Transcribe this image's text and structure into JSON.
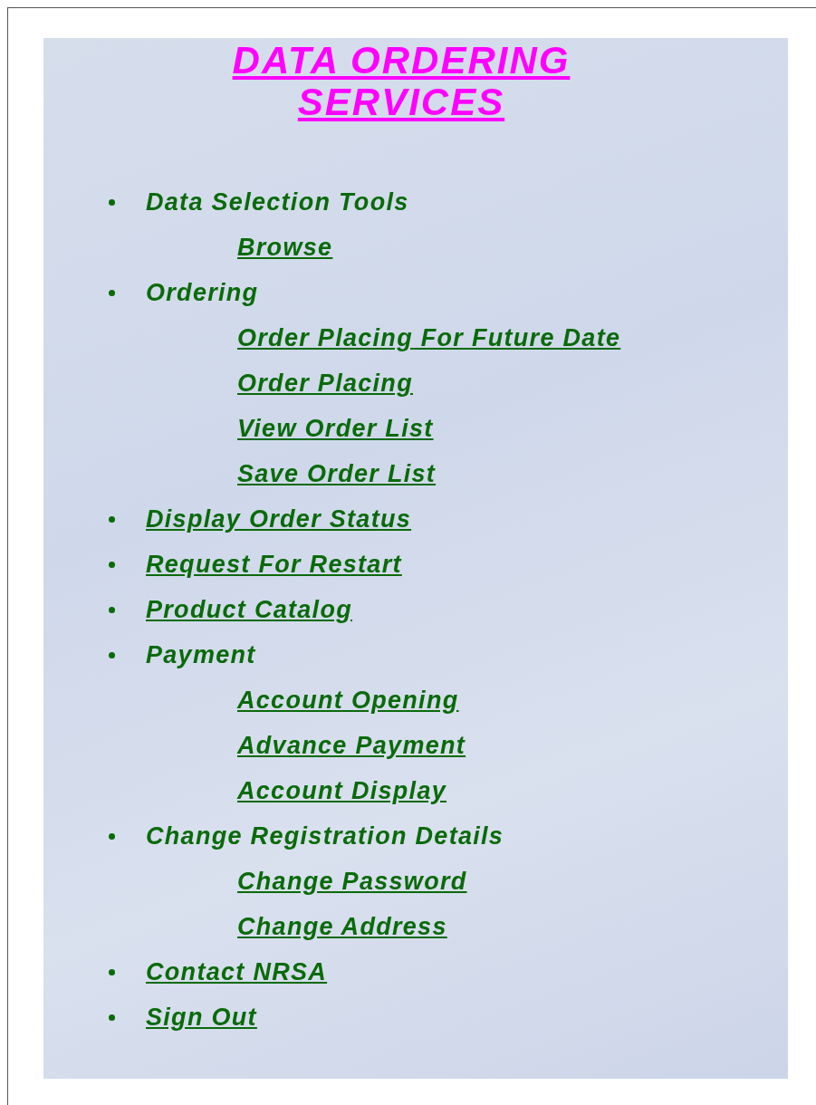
{
  "title": [
    "DATA ORDERING",
    "SERVICES"
  ],
  "menu": [
    {
      "label": "Data Selection Tools",
      "link": false,
      "children": [
        {
          "label": "Browse"
        }
      ]
    },
    {
      "label": "Ordering",
      "link": false,
      "children": [
        {
          "label": "Order Placing For Future Date"
        },
        {
          "label": "Order Placing"
        },
        {
          "label": "View Order List"
        },
        {
          "label": "Save Order List"
        }
      ]
    },
    {
      "label": "Display Order Status",
      "link": true
    },
    {
      "label": "Request For Restart",
      "link": true
    },
    {
      "label": "Product Catalog",
      "link": true
    },
    {
      "label": "Payment",
      "link": false,
      "children": [
        {
          "label": "Account Opening"
        },
        {
          "label": "Advance Payment"
        },
        {
          "label": "Account Display"
        }
      ]
    },
    {
      "label": "Change Registration Details",
      "link": false,
      "children": [
        {
          "label": "Change Password"
        },
        {
          "label": "Change Address"
        }
      ]
    },
    {
      "label": "Contact NRSA",
      "link": true
    },
    {
      "label": "Sign Out",
      "link": true
    }
  ]
}
